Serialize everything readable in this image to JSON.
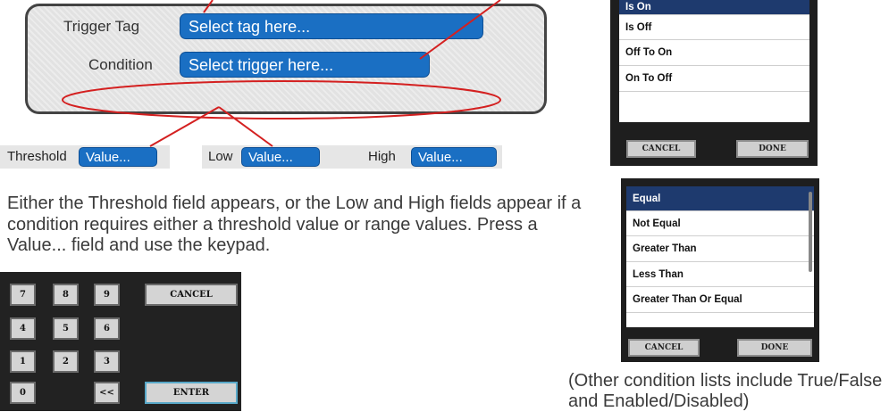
{
  "trigger_panel": {
    "trigger_tag_label": "Trigger Tag",
    "trigger_tag_placeholder": "Select tag here...",
    "condition_label": "Condition",
    "condition_placeholder": "Select trigger here..."
  },
  "value_fields": {
    "threshold_label": "Threshold",
    "threshold_value": "Value...",
    "low_label": "Low",
    "low_value": "Value...",
    "high_label": "High",
    "high_value": "Value..."
  },
  "description": "Either the Threshold field appears, or the Low and High fields appear if a condition requires either a threshold value or range values. Press a Value... field and use the keypad.",
  "keypad": {
    "keys": [
      "7",
      "8",
      "9",
      "4",
      "5",
      "6",
      "1",
      "2",
      "3",
      "0",
      "<<"
    ],
    "cancel_label": "CANCEL",
    "enter_label": "ENTER"
  },
  "dialog_onoff": {
    "items": [
      "Is On",
      "Is Off",
      "Off To On",
      "On To Off"
    ],
    "selected": "Is On",
    "cancel_label": "CANCEL",
    "done_label": "DONE"
  },
  "dialog_compare": {
    "items": [
      "Equal",
      "Not Equal",
      "Greater Than",
      "Less Than",
      "Greater Than Or Equal"
    ],
    "selected": "Equal",
    "cancel_label": "CANCEL",
    "done_label": "DONE"
  },
  "note": "(Other condition lists include True/False and Enabled/Disabled)",
  "colors": {
    "field_blue": "#1a6fc3",
    "selected_navy": "#1e3a6e",
    "callout_red": "#d42020"
  }
}
